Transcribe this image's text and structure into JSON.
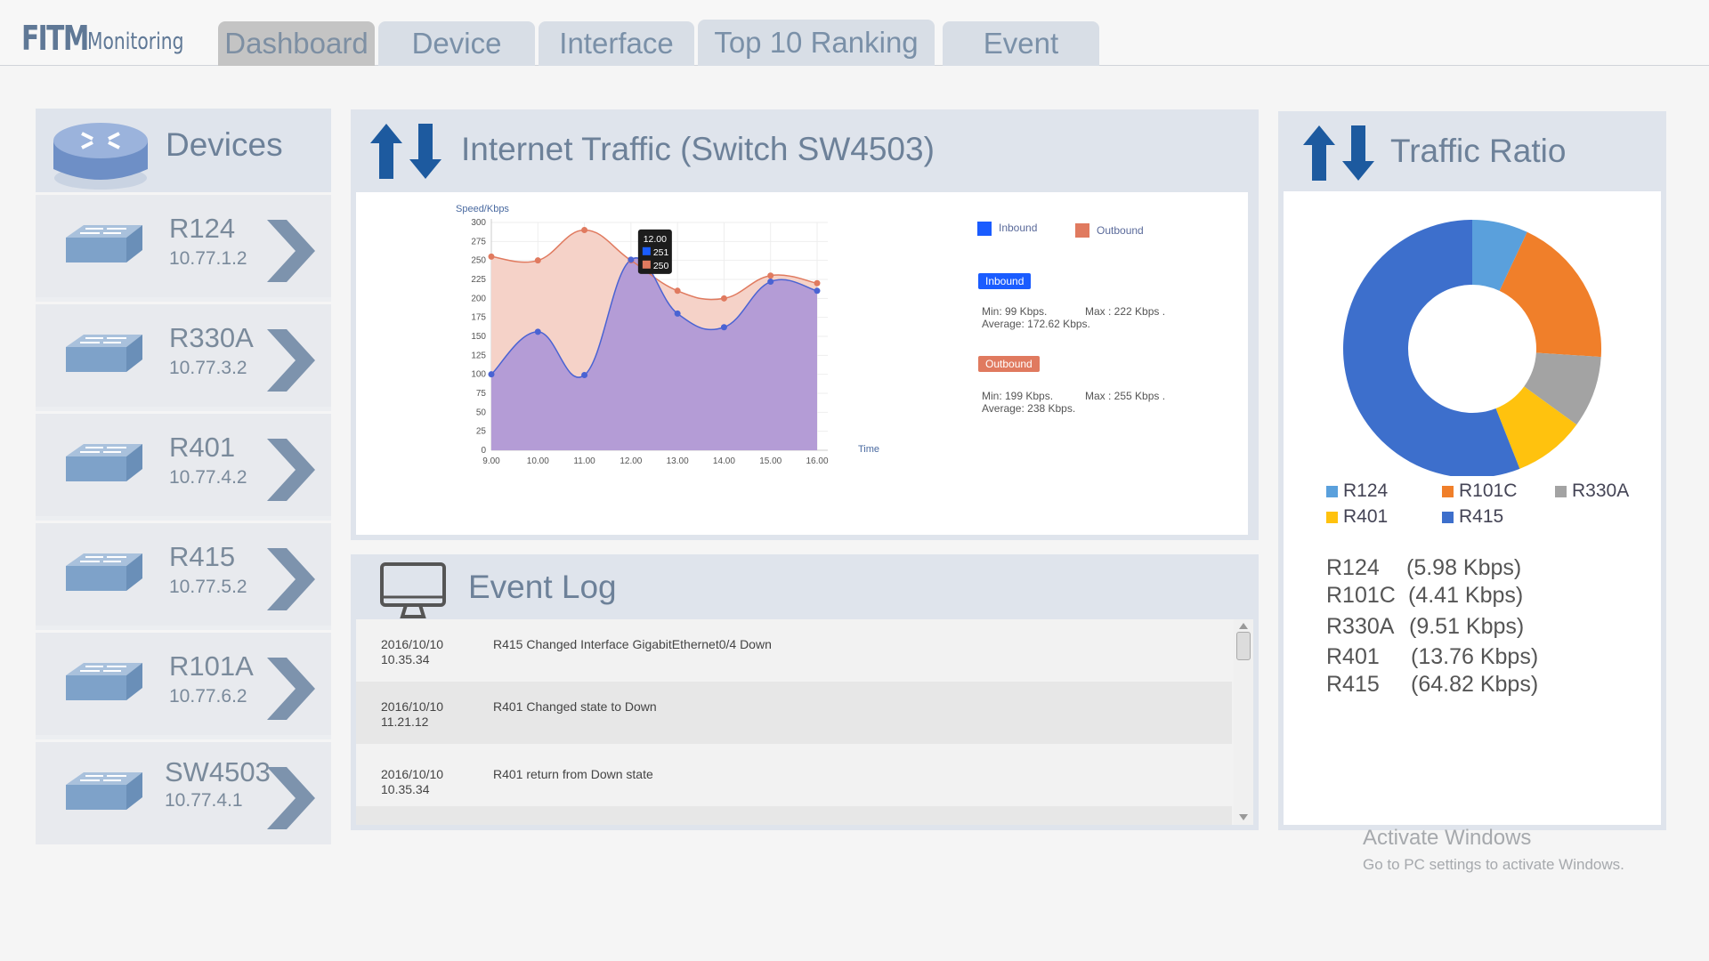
{
  "logo": {
    "bold": "FITM",
    "light": "Monitoring"
  },
  "tabs": [
    {
      "label": "Dashboard"
    },
    {
      "label": "Device"
    },
    {
      "label": "Interface"
    },
    {
      "label": "Top 10 Ranking"
    },
    {
      "label": "Event"
    }
  ],
  "devices": {
    "title": "Devices",
    "items": [
      {
        "name": "R124",
        "ip": "10.77.1.2"
      },
      {
        "name": "R330A",
        "ip": "10.77.3.2"
      },
      {
        "name": "R401",
        "ip": "10.77.4.2"
      },
      {
        "name": "R415",
        "ip": "10.77.5.2"
      },
      {
        "name": "R101A",
        "ip": "10.77.6.2"
      },
      {
        "name": "SW4503",
        "ip": "10.77.4.1"
      }
    ]
  },
  "traffic": {
    "title": "Internet Traffic (Switch SW4503)",
    "legend_inbound": "Inbound",
    "legend_outbound": "Outbound",
    "inbound_badge": "Inbound",
    "inbound_min": "Min:  99 Kbps.",
    "inbound_max": "Max : 222 Kbps .",
    "inbound_avg": "Average: 172.62 Kbps.",
    "outbound_badge": "Outbound",
    "outbound_min": "Min:  199 Kbps.",
    "outbound_max": "Max : 255 Kbps .",
    "outbound_avg": "Average: 238 Kbps.",
    "tooltip_title": "12.00",
    "tooltip_in": "251",
    "tooltip_out": "250",
    "colors": {
      "inbound": "#1a5cff",
      "outbound": "#e07a5f",
      "inbound_line": "#4a63d3",
      "inbound_fill": "#b49cd6",
      "outbound_fill": "#f5d2c8"
    }
  },
  "chart_data": {
    "type": "area",
    "ylabel": "Speed/Kbps",
    "xlabel": "Time",
    "x": [
      "9.00",
      "10.00",
      "11.00",
      "12.00",
      "13.00",
      "14.00",
      "15.00",
      "16.00"
    ],
    "ylim": [
      0,
      300
    ],
    "yticks": [
      0,
      25,
      50,
      75,
      100,
      125,
      150,
      175,
      200,
      225,
      250,
      275,
      300
    ],
    "series": [
      {
        "name": "Outbound",
        "values": [
          255,
          250,
          290,
          250,
          210,
          200,
          230,
          220
        ]
      },
      {
        "name": "Inbound",
        "values": [
          100,
          156,
          99,
          251,
          180,
          162,
          222,
          210
        ]
      }
    ]
  },
  "eventlog": {
    "title": "Event Log",
    "rows": [
      {
        "date": "2016/10/10",
        "time": "10.35.34",
        "msg": "R415  Changed Interface GigabitEthernet0/4 Down"
      },
      {
        "date": "2016/10/10",
        "time": "11.21.12",
        "msg": "R401  Changed state to  Down"
      },
      {
        "date": "2016/10/10",
        "time": "10.35.34",
        "msg": "R401 return from Down state"
      }
    ]
  },
  "ratio": {
    "title": "Traffic Ratio",
    "legend": [
      {
        "name": "R124",
        "color": "#5aa0dc"
      },
      {
        "name": "R101C",
        "color": "#f07f2a"
      },
      {
        "name": "R330A",
        "color": "#a3a3a3"
      },
      {
        "name": "R401",
        "color": "#ffc20e"
      },
      {
        "name": "R415",
        "color": "#3d6fcc"
      }
    ],
    "rows": [
      {
        "name": "R124",
        "val": "(5.98 Kbps)"
      },
      {
        "name": "R101C",
        "val": "(4.41 Kbps)"
      },
      {
        "name": "R330A",
        "val": "(9.51 Kbps)"
      },
      {
        "name": "R401",
        "val": "(13.76 Kbps)"
      },
      {
        "name": "R415",
        "val": "(64.82 Kbps)"
      }
    ],
    "slices": [
      {
        "name": "R124",
        "value": 7,
        "color": "#5aa0dc"
      },
      {
        "name": "R101C",
        "value": 19,
        "color": "#f07f2a"
      },
      {
        "name": "R330A",
        "value": 9,
        "color": "#a3a3a3"
      },
      {
        "name": "R401",
        "value": 9,
        "color": "#ffc20e"
      },
      {
        "name": "R415",
        "value": 56,
        "color": "#3d6fcc"
      }
    ]
  },
  "watermark": {
    "line1": "Activate Windows",
    "line2": "Go to PC settings to activate Windows."
  }
}
